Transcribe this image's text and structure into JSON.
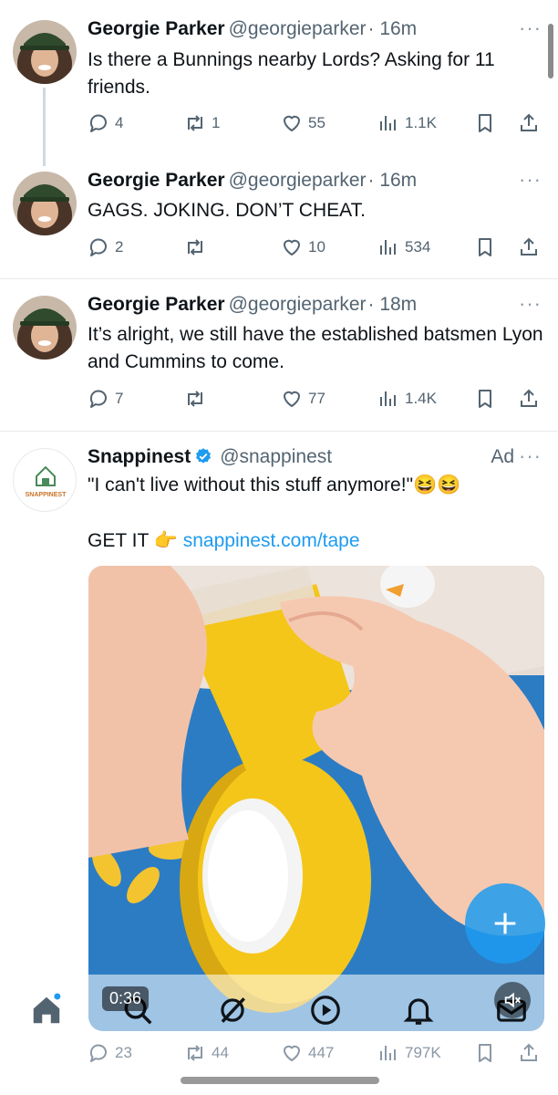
{
  "tweets": [
    {
      "name": "Georgie Parker",
      "handle": "@georgieparker",
      "time": "· 16m",
      "text": "Is there a Bunnings nearby Lords?  Asking for 11 friends.",
      "replies": "4",
      "retweets": "1",
      "likes": "55",
      "views": "1.1K"
    },
    {
      "name": "Georgie Parker",
      "handle": "@georgieparker",
      "time": "· 16m",
      "text": "GAGS. JOKING. DON’T CHEAT.",
      "replies": "2",
      "retweets": "",
      "likes": "10",
      "views": "534"
    },
    {
      "name": "Georgie Parker",
      "handle": "@georgieparker",
      "time": "· 18m",
      "text": "It’s alright, we still have the established batsmen Lyon and Cummins to come.",
      "replies": "7",
      "retweets": "",
      "likes": "77",
      "views": "1.4K"
    }
  ],
  "ad": {
    "name": "Snappinest",
    "handle": "@snappinest",
    "label": "Ad",
    "avatar_text": "SNAPPINEST",
    "text": "\"I can't live without this stuff anymore!\"😆😆",
    "cta_prefix": "GET IT 👉",
    "link": "snappinest.com/tape",
    "video_time": "0:36",
    "replies": "23",
    "retweets": "44",
    "likes": "447",
    "views": "797K"
  },
  "more_glyph": "···",
  "icons": {
    "reply": "reply-icon",
    "retweet": "retweet-icon",
    "like": "heart-icon",
    "views": "views-icon",
    "bookmark": "bookmark-icon",
    "share": "share-icon"
  },
  "tabbar": [
    "home-icon",
    "search-icon",
    "grok-icon",
    "video-icon",
    "bell-icon",
    "mail-icon"
  ],
  "colors": {
    "accent": "#1d9bf0",
    "text": "#0f1419",
    "muted": "#536471",
    "tape": "#f4c619"
  }
}
